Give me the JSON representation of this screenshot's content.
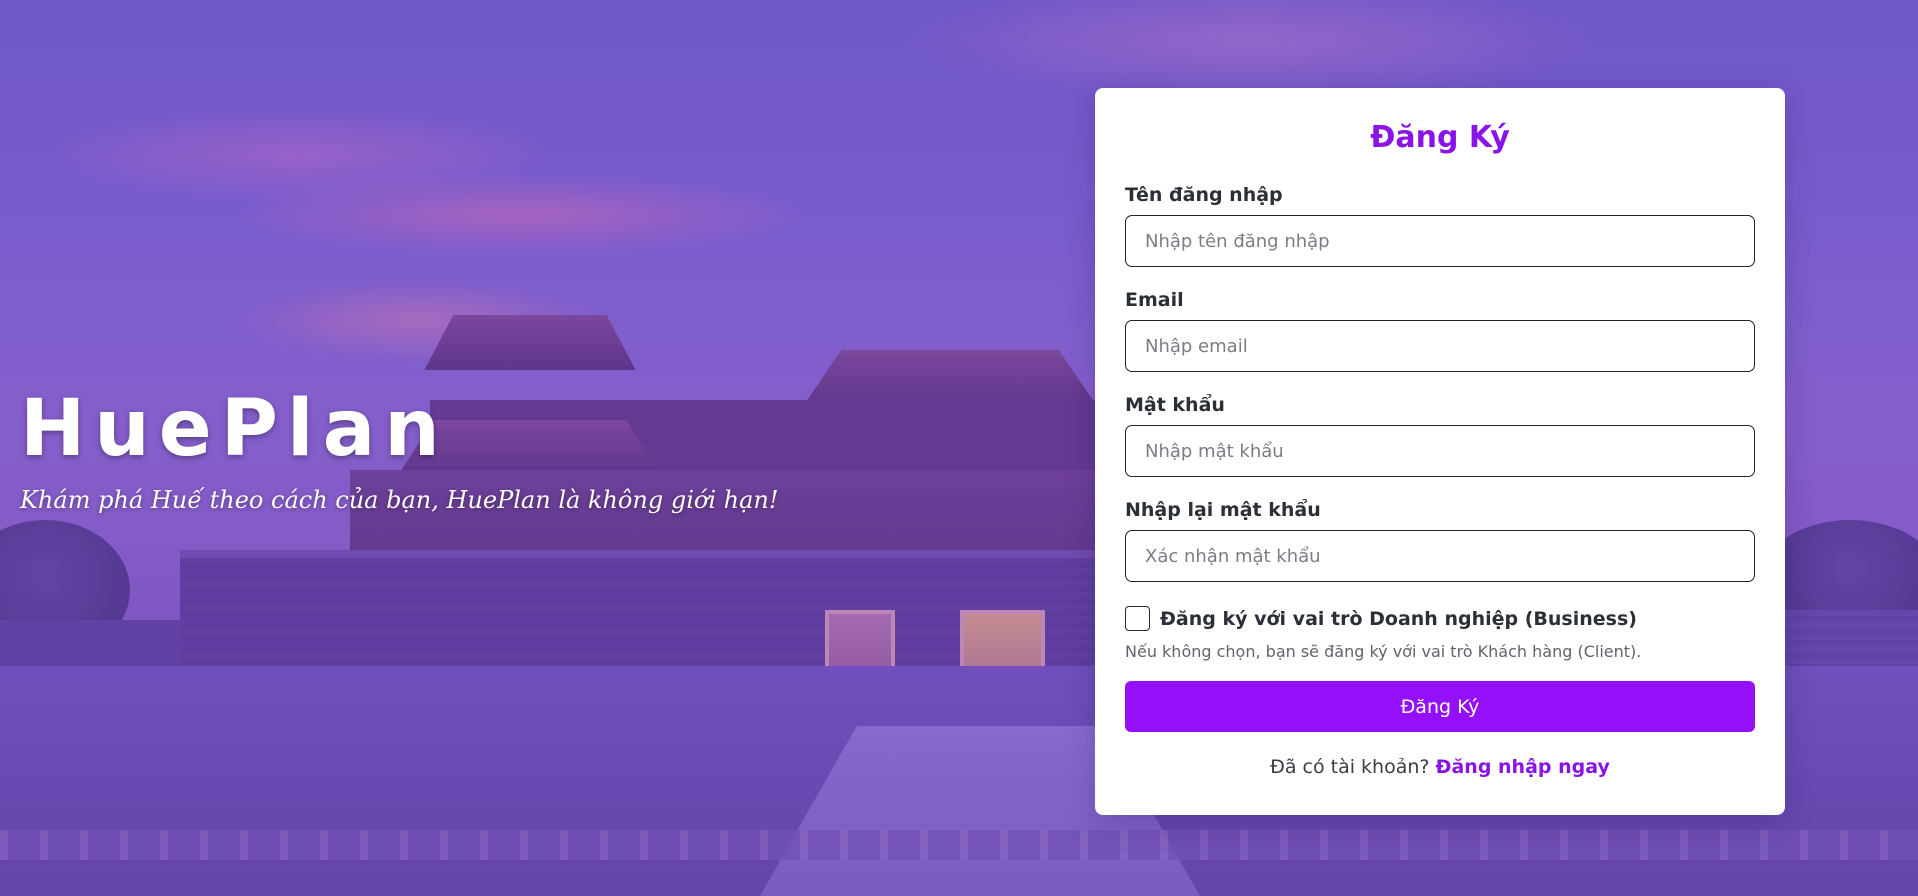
{
  "hero": {
    "brand": "HuePlan",
    "tagline": "Khám phá Huế theo cách của bạn, HuePlan là không giới hạn!"
  },
  "register": {
    "title": "Đăng Ký",
    "fields": [
      {
        "label": "Tên đăng nhập",
        "placeholder": "Nhập tên đăng nhập",
        "value": ""
      },
      {
        "label": "Email",
        "placeholder": "Nhập email",
        "value": ""
      },
      {
        "label": "Mật khẩu",
        "placeholder": "Nhập mật khẩu",
        "value": ""
      },
      {
        "label": "Nhập lại mật khẩu",
        "placeholder": "Xác nhận mật khẩu",
        "value": ""
      }
    ],
    "business_checkbox": {
      "label": "Đăng ký với vai trò Doanh nghiệp (Business)",
      "checked": false,
      "hint": "Nếu không chọn, bạn sẽ đăng ký với vai trò Khách hàng (Client)."
    },
    "submit_label": "Đăng Ký",
    "login_prompt": "Đã có tài khoản?",
    "login_link": "Đăng nhập ngay"
  },
  "colors": {
    "accent": "#8a14e6",
    "button": "#9410fa",
    "overlay": "#7846dc"
  }
}
